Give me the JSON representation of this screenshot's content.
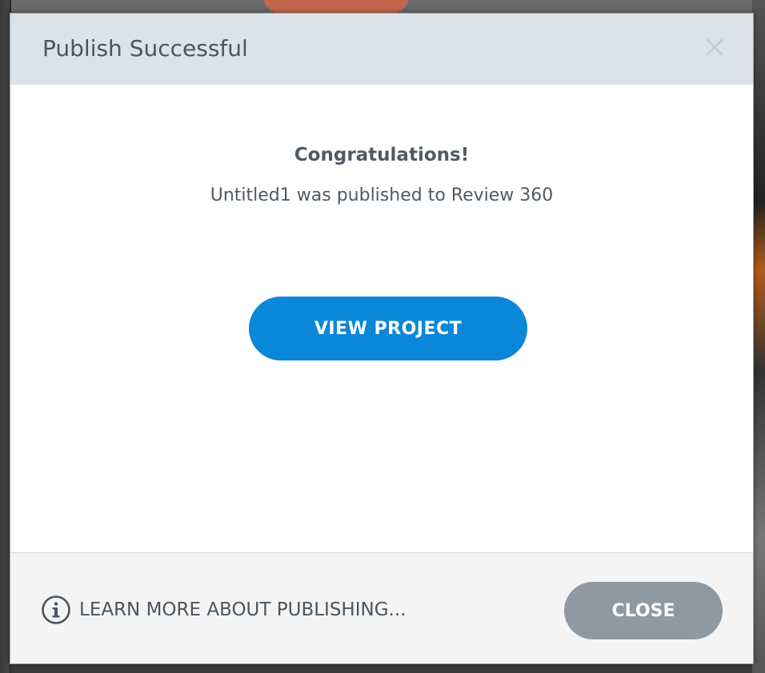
{
  "dialog": {
    "title": "Publish Successful",
    "close_icon": "close-icon"
  },
  "body": {
    "heading": "Congratulations!",
    "message": "Untitled1 was published to Review 360",
    "view_button_label": "VIEW PROJECT"
  },
  "footer": {
    "learn_more_icon": "info-icon",
    "learn_more_label": "LEARN MORE ABOUT PUBLISHING...",
    "close_button_label": "CLOSE"
  },
  "colors": {
    "header_bg": "#dce2e8",
    "primary_button": "#0a87d8",
    "secondary_button": "#8e99a2",
    "text": "#505a63",
    "footer_bg": "#f4f4f4"
  }
}
